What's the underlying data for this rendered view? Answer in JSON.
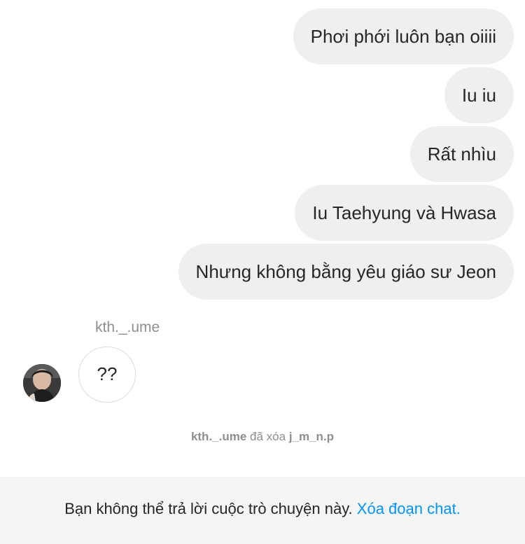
{
  "conversation": {
    "outgoing_messages": [
      "Phơi phới luôn bạn oiiii",
      "Iu iu",
      "Rất nhìu",
      "Iu Taehyung và Hwasa",
      "Nhưng không bằng yêu giáo sư Jeon"
    ],
    "incoming": {
      "sender": "kth._.ume",
      "message": "??"
    },
    "system_note": {
      "actor": "kth._.ume",
      "action": "đã xóa",
      "target": "j_m_n.p"
    }
  },
  "footer": {
    "notice": "Bạn không thể trả lời cuộc trò chuyện này.",
    "link_label": "Xóa đoạn chat."
  },
  "colors": {
    "outgoing_bubble": "#efefef",
    "incoming_border": "#dbdbdb",
    "muted_text": "#8e8e8e",
    "link": "#0095f6",
    "footer_bg": "#f5f5f5"
  }
}
